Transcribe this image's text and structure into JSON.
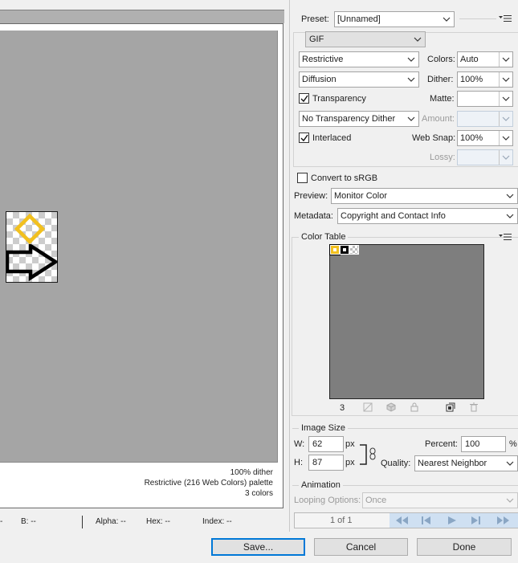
{
  "preview": {
    "status_dither": "100% dither",
    "status_palette": "Restrictive (216 Web Colors) palette",
    "status_colors": "3 colors"
  },
  "info_bar": {
    "b": "B: --",
    "alpha": "Alpha: --",
    "hex": "Hex: --",
    "index": "Index: --"
  },
  "settings": {
    "preset_label": "Preset:",
    "preset_value": "[Unnamed]",
    "format_value": "GIF",
    "reduction_value": "Restrictive",
    "colors_label": "Colors:",
    "colors_value": "Auto",
    "dither_algo_value": "Diffusion",
    "dither_label": "Dither:",
    "dither_value": "100%",
    "transparency_label": "Transparency",
    "matte_label": "Matte:",
    "matte_value": "",
    "transparency_dither_value": "No Transparency Dither",
    "amount_label": "Amount:",
    "amount_value": "",
    "interlaced_label": "Interlaced",
    "websnap_label": "Web Snap:",
    "websnap_value": "100%",
    "lossy_label": "Lossy:",
    "lossy_value": "",
    "convert_srgb_label": "Convert to sRGB",
    "preview_label": "Preview:",
    "preview_value": "Monitor Color",
    "metadata_label": "Metadata:",
    "metadata_value": "Copyright and Contact Info"
  },
  "color_table": {
    "title": "Color Table",
    "count": "3",
    "swatch_colors": [
      "#f2c01e",
      "#000000"
    ]
  },
  "image_size": {
    "title": "Image Size",
    "w_label": "W:",
    "w_value": "62",
    "h_label": "H:",
    "h_value": "87",
    "px": "px",
    "percent_label": "Percent:",
    "percent_value": "100",
    "percent_unit": "%",
    "quality_label": "Quality:",
    "quality_value": "Nearest Neighbor"
  },
  "animation": {
    "title": "Animation",
    "looping_label": "Looping Options:",
    "looping_value": "Once",
    "frame_counter": "1 of 1"
  },
  "buttons": {
    "save": "Save...",
    "cancel": "Cancel",
    "done": "Done"
  },
  "colors": {
    "accent": "#0078d7",
    "diamond": "#f2c01e"
  }
}
